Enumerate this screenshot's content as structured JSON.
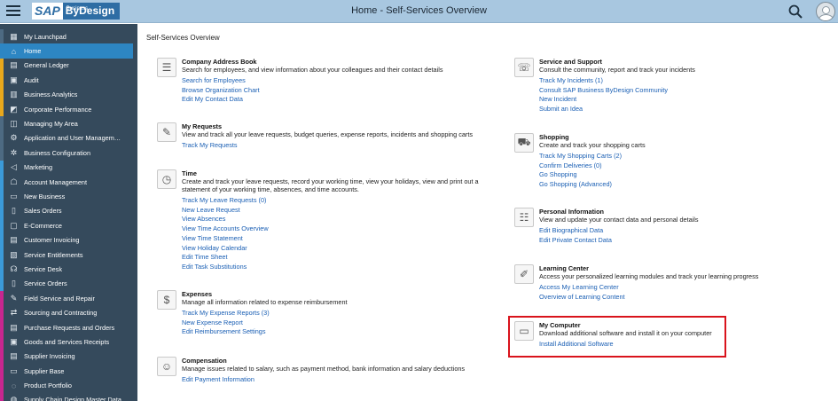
{
  "header": {
    "logo_main": "SAP",
    "logo_product": "ByDesign",
    "logo_super": "Business",
    "title": "Home - Self-Services Overview"
  },
  "sidebar": {
    "items": [
      {
        "label": "My Launchpad",
        "icon": "grid-icon",
        "glyph": "▦",
        "accent": "#4d6a82"
      },
      {
        "label": "Home",
        "icon": "home-icon",
        "glyph": "⌂",
        "accent": "#2d86c3",
        "active": true
      },
      {
        "label": "General Ledger",
        "icon": "ledger-icon",
        "glyph": "▤",
        "accent": "#e8a81c"
      },
      {
        "label": "Audit",
        "icon": "audit-icon",
        "glyph": "▣",
        "accent": "#e8a81c"
      },
      {
        "label": "Business Analytics",
        "icon": "analytics-icon",
        "glyph": "▥",
        "accent": "#e8a81c"
      },
      {
        "label": "Corporate Performance",
        "icon": "performance-icon",
        "glyph": "◩",
        "accent": "#e8a81c"
      },
      {
        "label": "Managing My Area",
        "icon": "area-icon",
        "glyph": "◫",
        "accent": "#4d6a82"
      },
      {
        "label": "Application and User Managem…",
        "icon": "user-admin-icon",
        "glyph": "⚙",
        "accent": "#4d6a82"
      },
      {
        "label": "Business Configuration",
        "icon": "config-icon",
        "glyph": "✲",
        "accent": "#4d6a82"
      },
      {
        "label": "Marketing",
        "icon": "megaphone-icon",
        "glyph": "◁",
        "accent": "#3b9ad9"
      },
      {
        "label": "Account Management",
        "icon": "account-icon",
        "glyph": "☖",
        "accent": "#3b9ad9"
      },
      {
        "label": "New Business",
        "icon": "new-business-icon",
        "glyph": "▭",
        "accent": "#3b9ad9"
      },
      {
        "label": "Sales Orders",
        "icon": "sales-orders-icon",
        "glyph": "▯",
        "accent": "#3b9ad9"
      },
      {
        "label": "E-Commerce",
        "icon": "ecommerce-icon",
        "glyph": "▢",
        "accent": "#3b9ad9"
      },
      {
        "label": "Customer Invoicing",
        "icon": "invoice-icon",
        "glyph": "▤",
        "accent": "#3b9ad9"
      },
      {
        "label": "Service Entitlements",
        "icon": "entitlement-icon",
        "glyph": "▧",
        "accent": "#3b9ad9"
      },
      {
        "label": "Service Desk",
        "icon": "headset-icon",
        "glyph": "☊",
        "accent": "#3b9ad9"
      },
      {
        "label": "Service Orders",
        "icon": "service-order-icon",
        "glyph": "▯",
        "accent": "#3b9ad9"
      },
      {
        "label": "Field Service and Repair",
        "icon": "wrench-icon",
        "glyph": "✎",
        "accent": "#c7268f"
      },
      {
        "label": "Sourcing and Contracting",
        "icon": "sourcing-icon",
        "glyph": "⇄",
        "accent": "#c7268f"
      },
      {
        "label": "Purchase Requests and Orders",
        "icon": "purchase-icon",
        "glyph": "▤",
        "accent": "#c7268f"
      },
      {
        "label": "Goods and Services Receipts",
        "icon": "receipt-icon",
        "glyph": "▣",
        "accent": "#c7268f"
      },
      {
        "label": "Supplier Invoicing",
        "icon": "supplier-invoice-icon",
        "glyph": "▤",
        "accent": "#c7268f"
      },
      {
        "label": "Supplier Base",
        "icon": "supplier-base-icon",
        "glyph": "▭",
        "accent": "#c7268f"
      },
      {
        "label": "Product Portfolio",
        "icon": "portfolio-icon",
        "glyph": "◌",
        "accent": "#c7268f"
      },
      {
        "label": "Supply Chain Design Master Data",
        "icon": "supply-chain-icon",
        "glyph": "◍",
        "accent": "#c7268f"
      }
    ]
  },
  "main": {
    "page_title": "Self-Services Overview",
    "left_cards": [
      {
        "key": "address-book",
        "icon": "address-book-icon",
        "glyph": "☰",
        "title": "Company Address Book",
        "desc": "Search for employees, and view information about your colleagues and their contact details",
        "links": [
          "Search for Employees",
          "Browse Organization Chart",
          "Edit My Contact Data"
        ]
      },
      {
        "key": "requests",
        "icon": "requests-icon",
        "glyph": "✎",
        "title": "My Requests",
        "desc": "View and track all your leave requests, budget queries, expense reports, incidents and shopping carts",
        "links": [
          "Track My Requests"
        ]
      },
      {
        "key": "time",
        "icon": "time-icon",
        "glyph": "◷",
        "title": "Time",
        "desc": "Create and track your leave requests, record your working time, view your holidays, view and print out a statement of your working time, absences, and time accounts.",
        "links": [
          "Track My Leave Requests (0)",
          "New Leave Request",
          "View Absences",
          "View Time Accounts Overview",
          "View Time Statement",
          "View Holiday Calendar",
          "Edit Time Sheet",
          "Edit Task Substitutions"
        ]
      },
      {
        "key": "expenses",
        "icon": "expenses-icon",
        "glyph": "$",
        "title": "Expenses",
        "desc": "Manage all information related to expense reimbursement",
        "links": [
          "Track My Expense Reports (3)",
          "New Expense Report",
          "Edit Reimbursement Settings"
        ]
      },
      {
        "key": "compensation",
        "icon": "compensation-icon",
        "glyph": "☺",
        "title": "Compensation",
        "desc": "Manage issues related to salary, such as payment method, bank information and salary deductions",
        "links": [
          "Edit Payment Information"
        ]
      }
    ],
    "right_cards": [
      {
        "key": "service-support",
        "icon": "service-support-icon",
        "glyph": "☏",
        "title": "Service and Support",
        "desc": "Consult the community, report and track your incidents",
        "links": [
          "Track My Incidents (1)",
          "Consult SAP Business ByDesign Community",
          "New Incident",
          "Submit an Idea"
        ]
      },
      {
        "key": "shopping",
        "icon": "shopping-cart-icon",
        "glyph": "⛟",
        "title": "Shopping",
        "desc": "Create and track your shopping carts",
        "links": [
          "Track My Shopping Carts (2)",
          "Confirm Deliveries (0)",
          "Go Shopping",
          "Go Shopping (Advanced)"
        ]
      },
      {
        "key": "personal-info",
        "icon": "personal-info-icon",
        "glyph": "☷",
        "title": "Personal Information",
        "desc": "View and update your contact data and personal details",
        "links": [
          "Edit Biographical Data",
          "Edit Private Contact Data"
        ]
      },
      {
        "key": "learning",
        "icon": "learning-icon",
        "glyph": "✐",
        "title": "Learning Center",
        "desc": "Access your personalized learning modules and track your learning progress",
        "links": [
          "Access My Learning Center",
          "Overview of Learning Content"
        ]
      },
      {
        "key": "my-computer",
        "icon": "computer-icon",
        "glyph": "▭",
        "title": "My Computer",
        "desc": "Download additional software and install it on your computer",
        "links": [
          "Install Additional Software"
        ]
      }
    ]
  }
}
